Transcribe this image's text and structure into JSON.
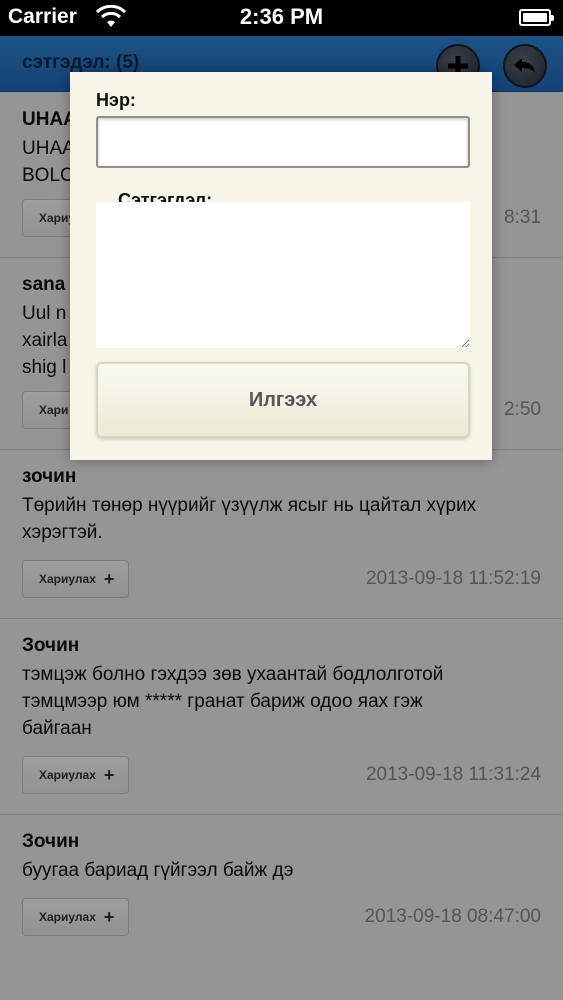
{
  "status_bar": {
    "carrier": "Carrier",
    "time": "2:36 PM",
    "battery_level": 1.0
  },
  "nav": {
    "title": "сэтгэдэл: (5)",
    "add_icon": "plus-icon",
    "back_icon": "back-arrow-icon"
  },
  "comments": [
    {
      "name": "UHAA",
      "text": "UHAA                                         D BJ\nBOLC",
      "reply_label": "Хариу",
      "date": "8:31"
    },
    {
      "name": "sana",
      "text": "Uul n\nxairla                                          dlux\nshig l",
      "reply_label": "Хари",
      "date": "2:50"
    },
    {
      "name": "зочин",
      "text": "Төрийн төнөр нүүрийг үзүүлж ясыг нь цайтал хүрих\nхэрэгтэй.",
      "reply_label": "Хариулах",
      "date": "2013-09-18 11:52:19"
    },
    {
      "name": "Зочин",
      "text": "тэмцэж болно гэхдээ зөв ухаантай бодлолготой\nтэмцмээр юм ***** гранат бариж одоо яах гэж\nбайгаан",
      "reply_label": "Хариулах",
      "date": "2013-09-18 11:31:24"
    },
    {
      "name": "Зочин",
      "text": "буугаа бариад гүйгээл байж дэ",
      "reply_label": "Хариулах",
      "date": "2013-09-18 08:47:00"
    }
  ],
  "modal": {
    "name_label": "Нэр:",
    "name_value": "",
    "comment_label": "Сэтгэгдэл:",
    "comment_value": "",
    "submit_label": "Илгээх"
  },
  "colors": {
    "nav_blue": "#1e6cbf",
    "modal_bg": "#f6f5e8"
  }
}
